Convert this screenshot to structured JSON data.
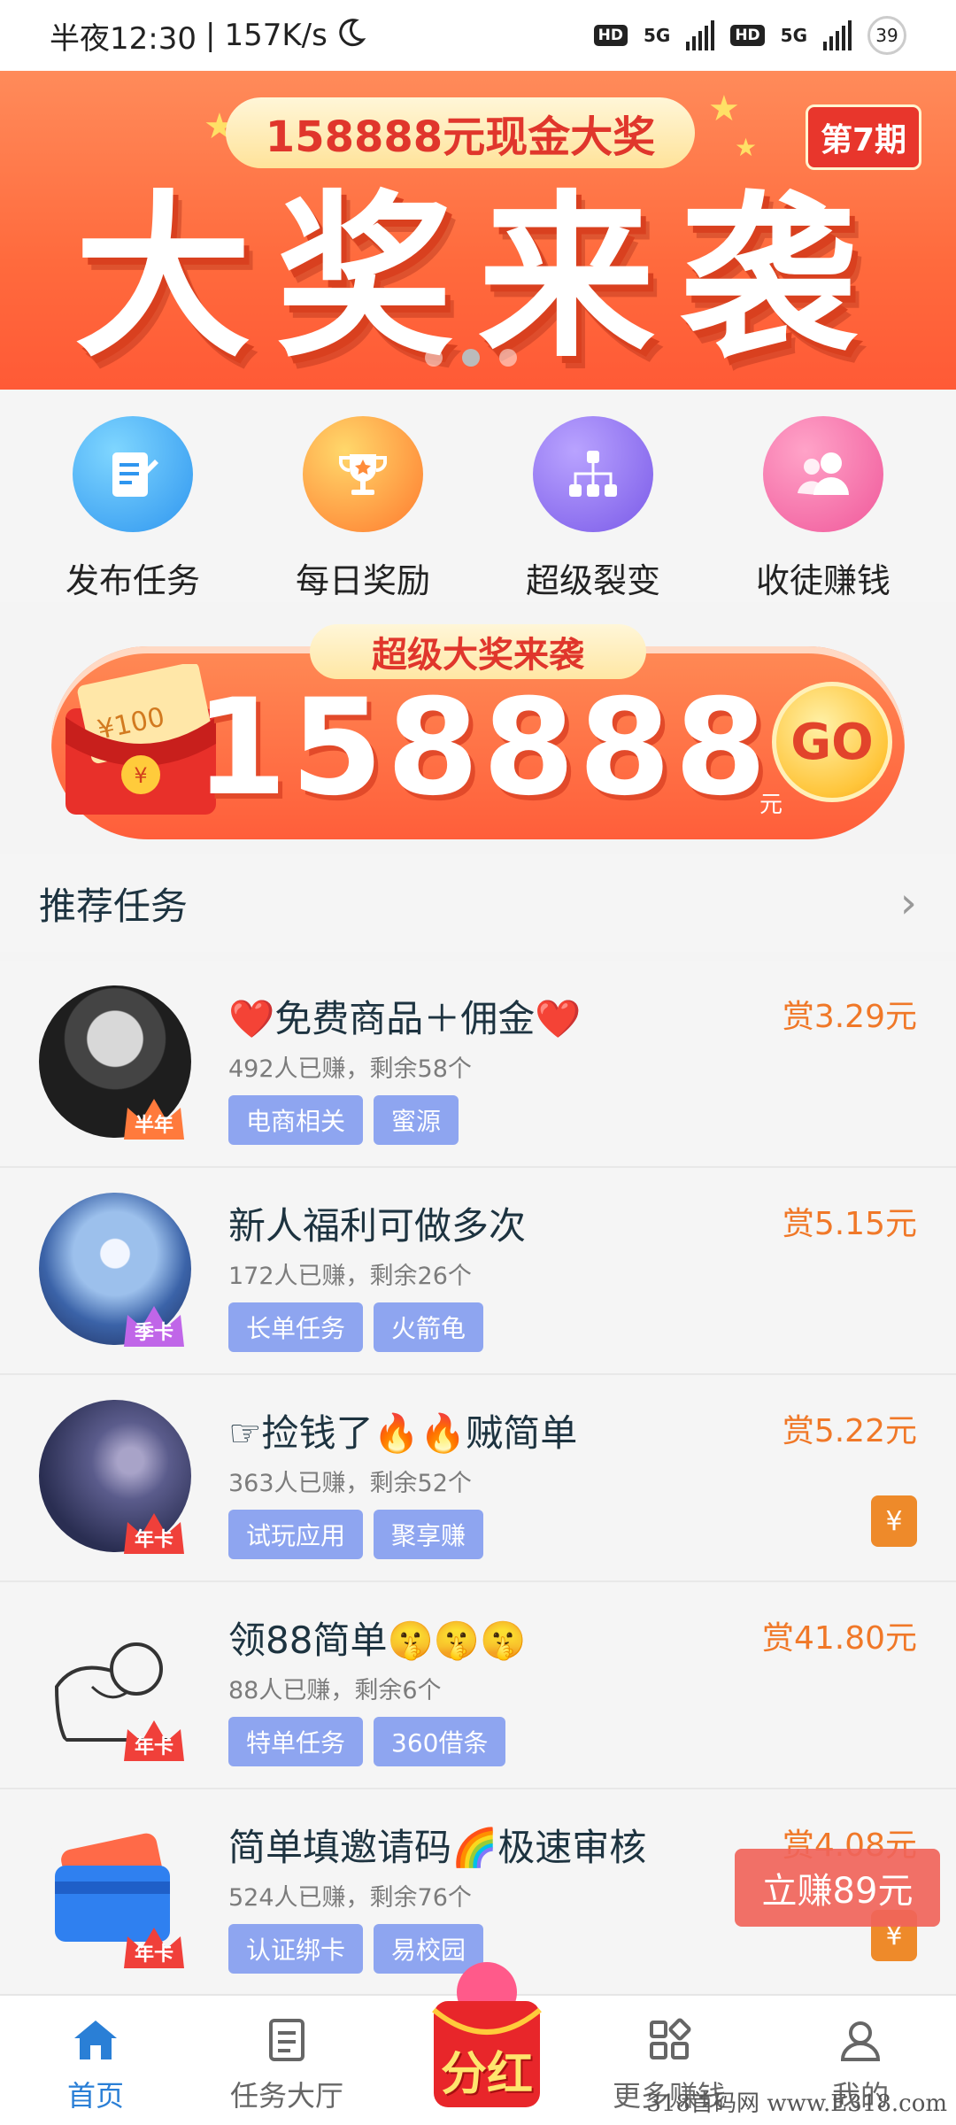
{
  "status_bar": {
    "time": "半夜12:30",
    "speed": "157K/s",
    "hd1": "HD",
    "net1": "5G",
    "hd2": "HD",
    "net2": "5G",
    "battery": "39"
  },
  "top_banner": {
    "prize": "158888元现金大奖",
    "period": "第7期",
    "headline": "大奖来袭"
  },
  "quick_actions": [
    {
      "label": "发布任务",
      "icon": "edit-icon",
      "color": "#3fa9f5"
    },
    {
      "label": "每日奖励",
      "icon": "trophy-icon",
      "color": "#ff8c3a"
    },
    {
      "label": "超级裂变",
      "icon": "network-icon",
      "color": "#8b6ff0"
    },
    {
      "label": "收徒赚钱",
      "icon": "users-icon",
      "color": "#f46aa0"
    }
  ],
  "promo": {
    "tag": "超级大奖来袭",
    "amount": "158888",
    "unit": "元",
    "go": "GO",
    "packet_value": "¥100"
  },
  "section": {
    "title": "推荐任务"
  },
  "tasks": [
    {
      "title": "❤️免费商品＋佣金❤️",
      "meta": "492人已赚，剩余58个",
      "tags": [
        "电商相关",
        "蜜源"
      ],
      "reward": "赏3.29元",
      "badge": "半年"
    },
    {
      "title": "新人福利可做多次",
      "meta": "172人已赚，剩余26个",
      "tags": [
        "长单任务",
        "火箭龟"
      ],
      "reward": "赏5.15元",
      "badge": "季卡"
    },
    {
      "title": "☞捡钱了🔥🔥贼简单",
      "meta": "363人已赚，剩余52个",
      "tags": [
        "试玩应用",
        "聚享赚"
      ],
      "reward": "赏5.22元",
      "badge": "年卡",
      "yen": "¥"
    },
    {
      "title": "领88简单🤫🤫🤫",
      "meta": "88人已赚，剩余6个",
      "tags": [
        "特单任务",
        "360借条"
      ],
      "reward": "赏41.80元",
      "badge": "年卡"
    },
    {
      "title": "简单填邀请码🌈极速审核",
      "meta": "524人已赚，剩余76个",
      "tags": [
        "认证绑卡",
        "易校园"
      ],
      "reward": "赏4.08元",
      "badge": "年卡",
      "yen": "¥"
    }
  ],
  "floating": {
    "earn": "立赚89元"
  },
  "bottom_nav": {
    "items": [
      {
        "label": "首页"
      },
      {
        "label": "任务大厅"
      },
      {
        "label": "更多赚钱"
      },
      {
        "label": "我的"
      }
    ],
    "center": "分红"
  },
  "watermark": "318首码网 www.E318.com"
}
